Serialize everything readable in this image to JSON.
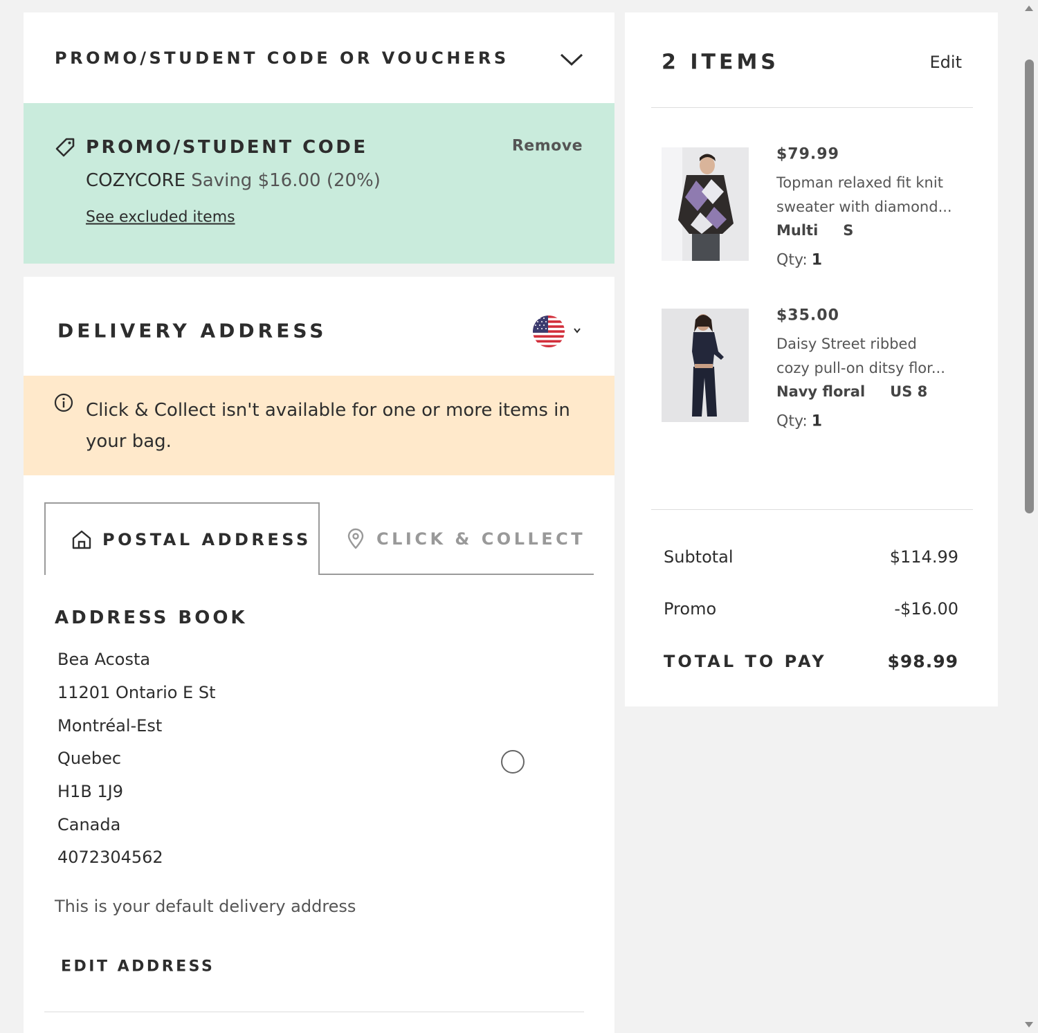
{
  "promo_header": {
    "title": "PROMO/STUDENT CODE OR VOUCHERS",
    "toggle_icon": "chevron-down-icon"
  },
  "promo_applied": {
    "title": "PROMO/STUDENT CODE",
    "remove_label": "Remove",
    "code": "COZYCORE",
    "saving_text": "Saving $16.00 (20%)",
    "excluded_link": "See excluded items",
    "icon": "tag-icon",
    "bg_color": "#c9ebdc"
  },
  "delivery": {
    "title": "DELIVERY ADDRESS",
    "country_icon": "us-flag-icon",
    "notice": {
      "icon": "info-icon",
      "text": "Click & Collect isn't available for one or more items in your bag.",
      "bg_color": "#ffe9cb"
    },
    "tabs": [
      {
        "label": "POSTAL ADDRESS",
        "icon": "home-icon",
        "active": true
      },
      {
        "label": "CLICK & COLLECT",
        "icon": "location-pin-icon",
        "active": false
      }
    ],
    "address_book": {
      "title": "ADDRESS BOOK",
      "lines": [
        "Bea Acosta",
        "11201 Ontario E St",
        "Montréal-Est",
        "Quebec",
        "H1B 1J9",
        "Canada",
        "4072304562"
      ],
      "default_note": "This is your default delivery address",
      "edit_label": "EDIT ADDRESS"
    }
  },
  "summary": {
    "title": "2 ITEMS",
    "edit_label": "Edit",
    "items": [
      {
        "price": "$79.99",
        "name_line1": "Topman relaxed fit knit",
        "name_line2": "sweater with diamond...",
        "color": "Multi",
        "size": "S",
        "qty_label": "Qty:",
        "qty": "1"
      },
      {
        "price": "$35.00",
        "name_line1": "Daisy Street ribbed",
        "name_line2": "cozy pull-on ditsy flor...",
        "color": "Navy floral",
        "size": "US 8",
        "qty_label": "Qty:",
        "qty": "1"
      }
    ],
    "totals": {
      "subtotal_label": "Subtotal",
      "subtotal": "$114.99",
      "promo_label": "Promo",
      "promo": "-$16.00",
      "total_label": "TOTAL TO PAY",
      "total": "$98.99"
    }
  }
}
